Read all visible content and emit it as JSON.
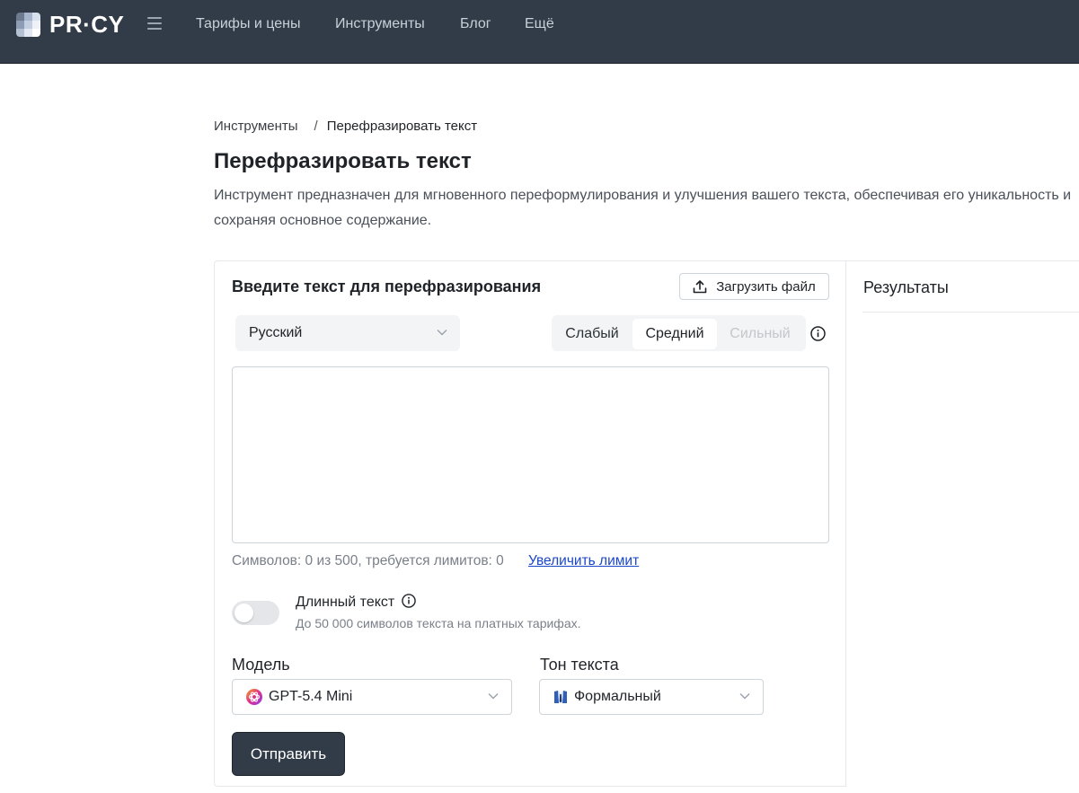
{
  "header": {
    "logo_text": "PR·CY",
    "nav": [
      "Тарифы и цены",
      "Инструменты",
      "Блог",
      "Ещё"
    ]
  },
  "breadcrumb": {
    "parent": "Инструменты",
    "separator": "/",
    "current": "Перефразировать текст"
  },
  "page": {
    "title": "Перефразировать текст",
    "description": "Инструмент предназначен для мгновенного переформулирования и улучшения вашего текста, обеспечивая его уникальность и сохраняя основное содержание."
  },
  "form": {
    "heading": "Введите текст для перефразирования",
    "upload_label": "Загрузить файл",
    "language": "Русский",
    "strength": {
      "options": [
        "Слабый",
        "Средний",
        "Сильный"
      ],
      "selected": "Средний"
    },
    "text_value": "",
    "counter": "Символов: 0 из 500, требуется лимитов: 0",
    "increase_limit": "Увеличить лимит",
    "long_text": {
      "label": "Длинный текст",
      "hint": "До 50 000 символов текста на платных тарифах.",
      "enabled": false
    },
    "model": {
      "label": "Модель",
      "value": "GPT-5.4 Mini"
    },
    "tone": {
      "label": "Тон текста",
      "value": "Формальный"
    },
    "submit_label": "Отправить"
  },
  "results": {
    "title": "Результаты"
  },
  "colors": {
    "header_bg": "#323c48",
    "link": "#1a46c8",
    "button_bg": "#323c48"
  }
}
